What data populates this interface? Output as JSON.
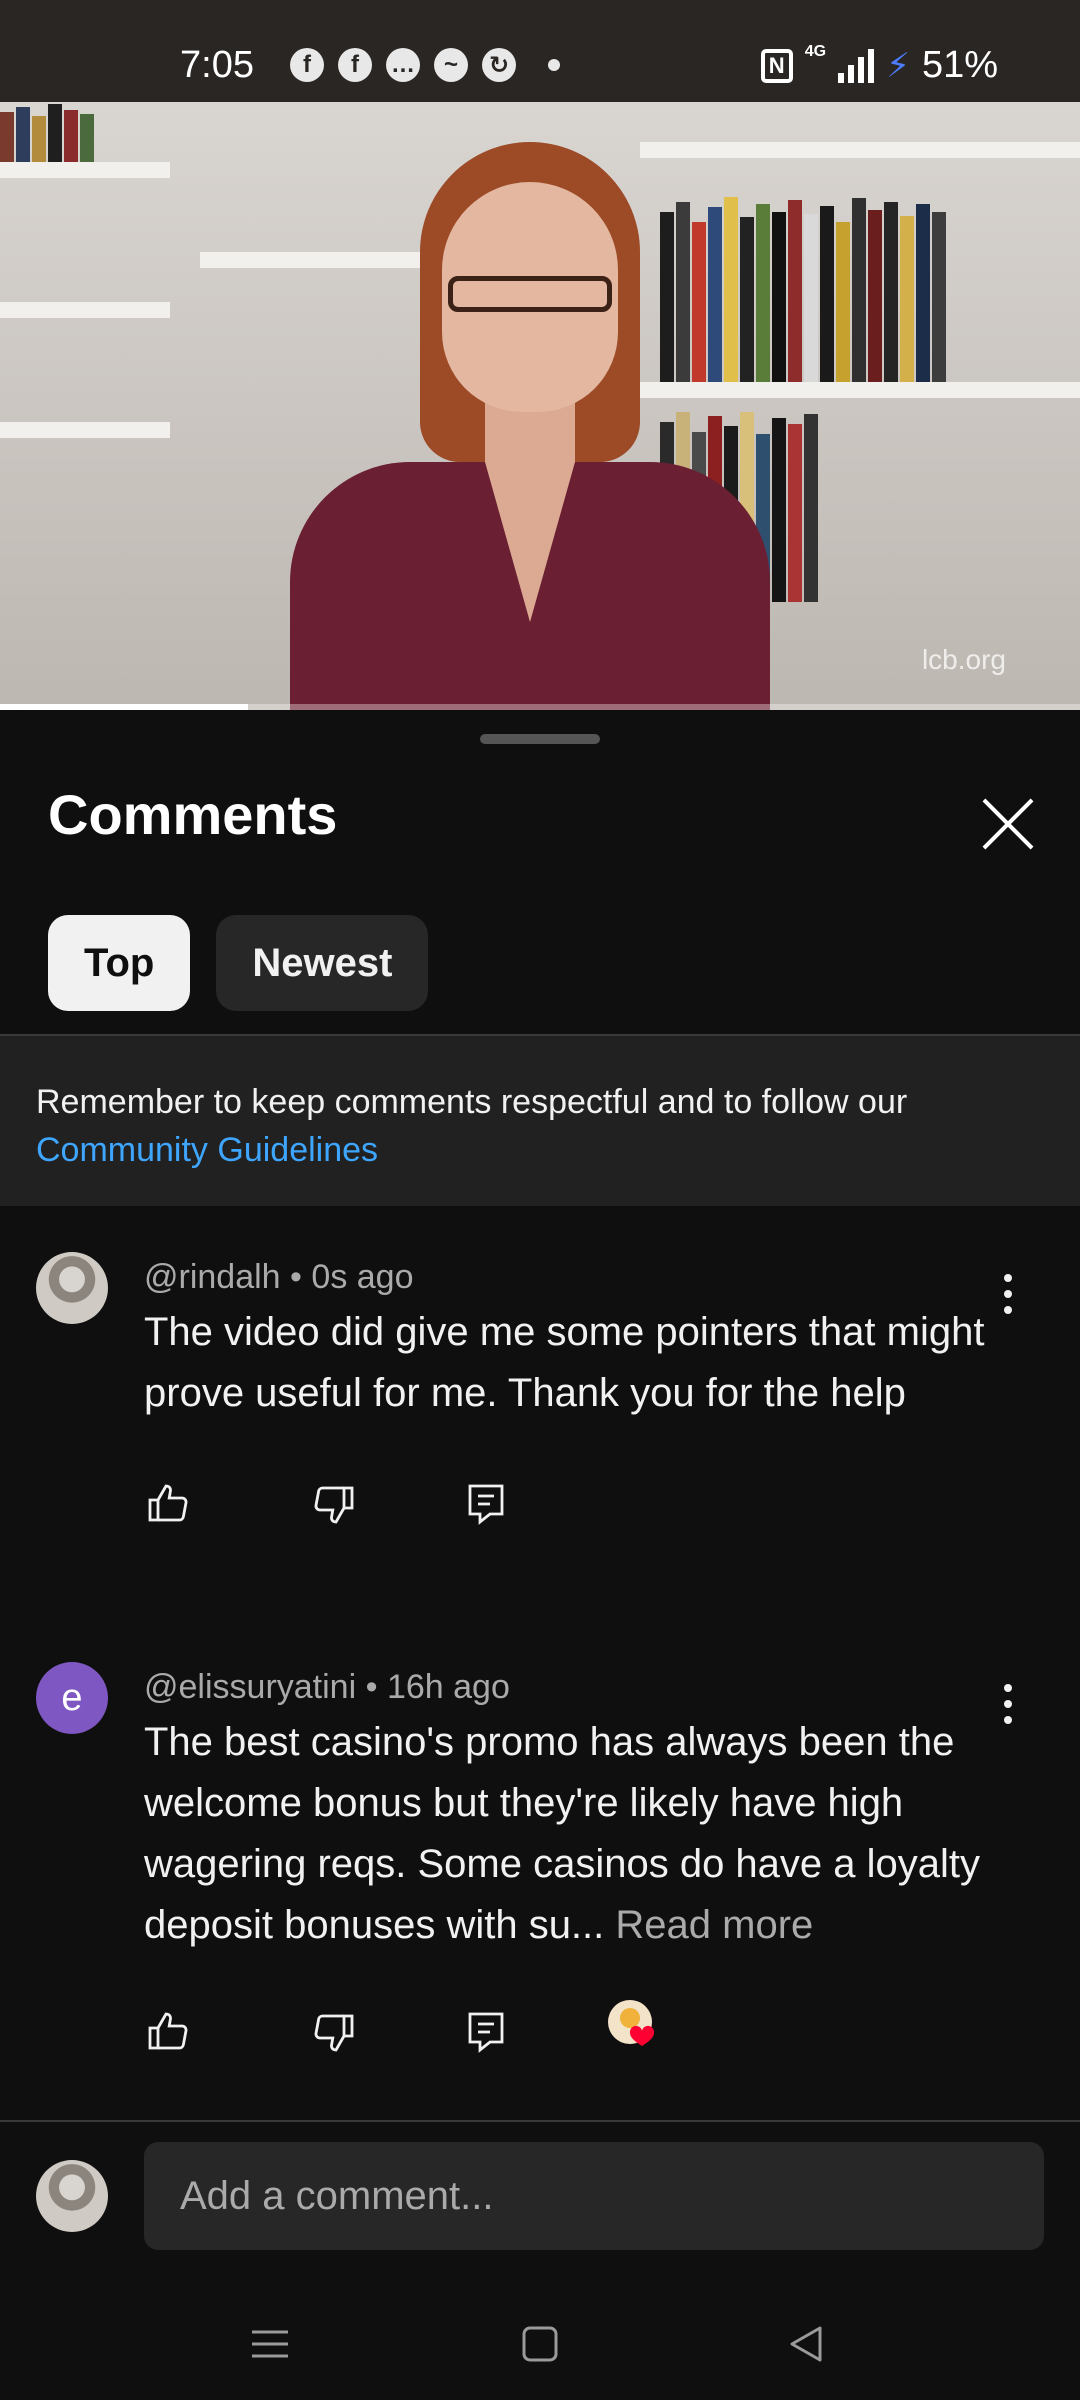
{
  "status_bar": {
    "time": "7:05",
    "notification_icons": [
      "facebook-icon",
      "facebook-icon",
      "chat-icon",
      "messenger-icon",
      "sync-app-icon"
    ],
    "network": "4G",
    "battery": "51%"
  },
  "video": {
    "watermark": "lcb.org",
    "progress_fraction": 0.23
  },
  "comments_sheet": {
    "title": "Comments",
    "tabs": [
      {
        "label": "Top",
        "active": true
      },
      {
        "label": "Newest",
        "active": false
      }
    ],
    "notice": {
      "text": "Remember to keep comments respectful and to follow our",
      "link": "Community Guidelines"
    },
    "comments": [
      {
        "author": "@rindalh",
        "time": "0s ago",
        "text": "The video did give me some pointers that might prove useful for me. Thank you for the help",
        "avatar": "photo"
      },
      {
        "author": "@elissuryatini",
        "time": "16h ago",
        "text": "The best casino's promo has always been the welcome bonus but they're likely have high wagering reqs. Some casinos do have a loyalty deposit bonuses with su...",
        "read_more": "Read more",
        "avatar_letter": "e",
        "creator_heart": true
      }
    ],
    "composer_placeholder": "Add a comment..."
  },
  "colors": {
    "background": "#0f0f0f",
    "link": "#3ea6ff",
    "avatar_letter_bg": "#7e57c2",
    "heart": "#ff0033"
  }
}
